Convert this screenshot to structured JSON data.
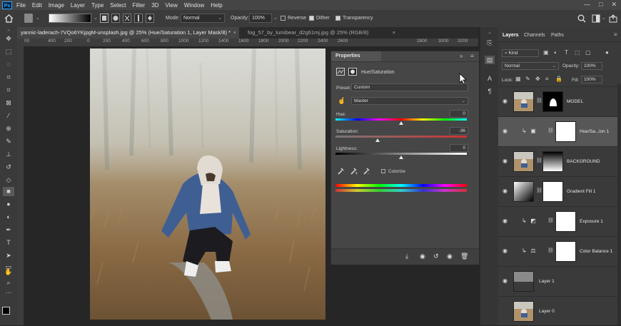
{
  "menu": {
    "app_icon": "Ps",
    "items": [
      "File",
      "Edit",
      "Image",
      "Layer",
      "Type",
      "Select",
      "Filter",
      "3D",
      "View",
      "Window",
      "Help"
    ],
    "window_controls": [
      "—",
      "□",
      "✕"
    ]
  },
  "options": {
    "mode_label": "Mode:",
    "mode_value": "Normal",
    "opacity_label": "Opacity:",
    "opacity_value": "100%",
    "reverse_label": "Reverse",
    "dither_label": "Dither",
    "transparency_label": "Transparency",
    "reverse_checked": false,
    "dither_checked": true,
    "transparency_checked": true
  },
  "tabs": [
    {
      "label": "yannic-laderach-7VQo6YKjpgM-unsplash.jpg @ 25% (Hue/Saturation 1, Layer Mask/8) *",
      "close": "×"
    },
    {
      "label": "fog_57_by_lumibear_d2g61mj.jpg @ 25% (RGB/8)",
      "close": "×"
    }
  ],
  "ruler": [
    "00",
    "400",
    "200",
    "0",
    "200",
    "400",
    "600",
    "800",
    "1000",
    "1200",
    "1400",
    "1600",
    "1800",
    "2000",
    "2200",
    "2400",
    "2600",
    "2800",
    "3000",
    "3200"
  ],
  "properties": {
    "tab_label": "Properties",
    "adjustment_name": "Hue/Saturation",
    "preset_label": "Preset:",
    "preset_value": "Custom",
    "channel_value": "Master",
    "hue_label": "Hue:",
    "hue_value": "0",
    "saturation_label": "Saturation:",
    "saturation_value": "-36",
    "lightness_label": "Lightness:",
    "lightness_value": "0",
    "colorize_label": "Colorize",
    "hue_fraction": 0.5,
    "saturation_fraction": 0.32,
    "lightness_fraction": 0.5
  },
  "layers_panel": {
    "tabs": [
      "Layers",
      "Channels",
      "Paths"
    ],
    "kind_value": "Kind",
    "blend_value": "Normal",
    "opacity_label": "Opacity:",
    "opacity_value": "100%",
    "lock_label": "Lock:",
    "fill_label": "Fill:",
    "fill_value": "100%",
    "layers": [
      {
        "name": "MODEL",
        "thumb": "photo",
        "mask": "model",
        "selected": false,
        "clipped": false,
        "adj_icon": ""
      },
      {
        "name": "Hue/Sa...ion 1",
        "thumb": "none",
        "mask": "white",
        "selected": true,
        "clipped": true,
        "adj_icon": "hue-sat-icon"
      },
      {
        "name": "BACKGROUND",
        "thumb": "photo",
        "mask": "gradient",
        "selected": false,
        "clipped": false,
        "adj_icon": ""
      },
      {
        "name": "Gradient Fill 1",
        "thumb": "gradient-fill",
        "mask": "white",
        "selected": false,
        "clipped": false,
        "adj_icon": ""
      },
      {
        "name": "Exposure 1",
        "thumb": "none",
        "mask": "white",
        "selected": false,
        "clipped": true,
        "adj_icon": "exposure-icon"
      },
      {
        "name": "Color Balance 1",
        "thumb": "none",
        "mask": "white",
        "selected": false,
        "clipped": true,
        "adj_icon": "color-balance-icon"
      },
      {
        "name": "Layer 1",
        "thumb": "fog",
        "mask": "",
        "selected": false,
        "clipped": false,
        "adj_icon": ""
      },
      {
        "name": "Layer 0",
        "thumb": "photo",
        "mask": "",
        "selected": false,
        "clipped": false,
        "adj_icon": ""
      }
    ]
  },
  "colors": {
    "accent": "#31a8ff",
    "panel_bg": "#464646",
    "selection": "#575757"
  }
}
